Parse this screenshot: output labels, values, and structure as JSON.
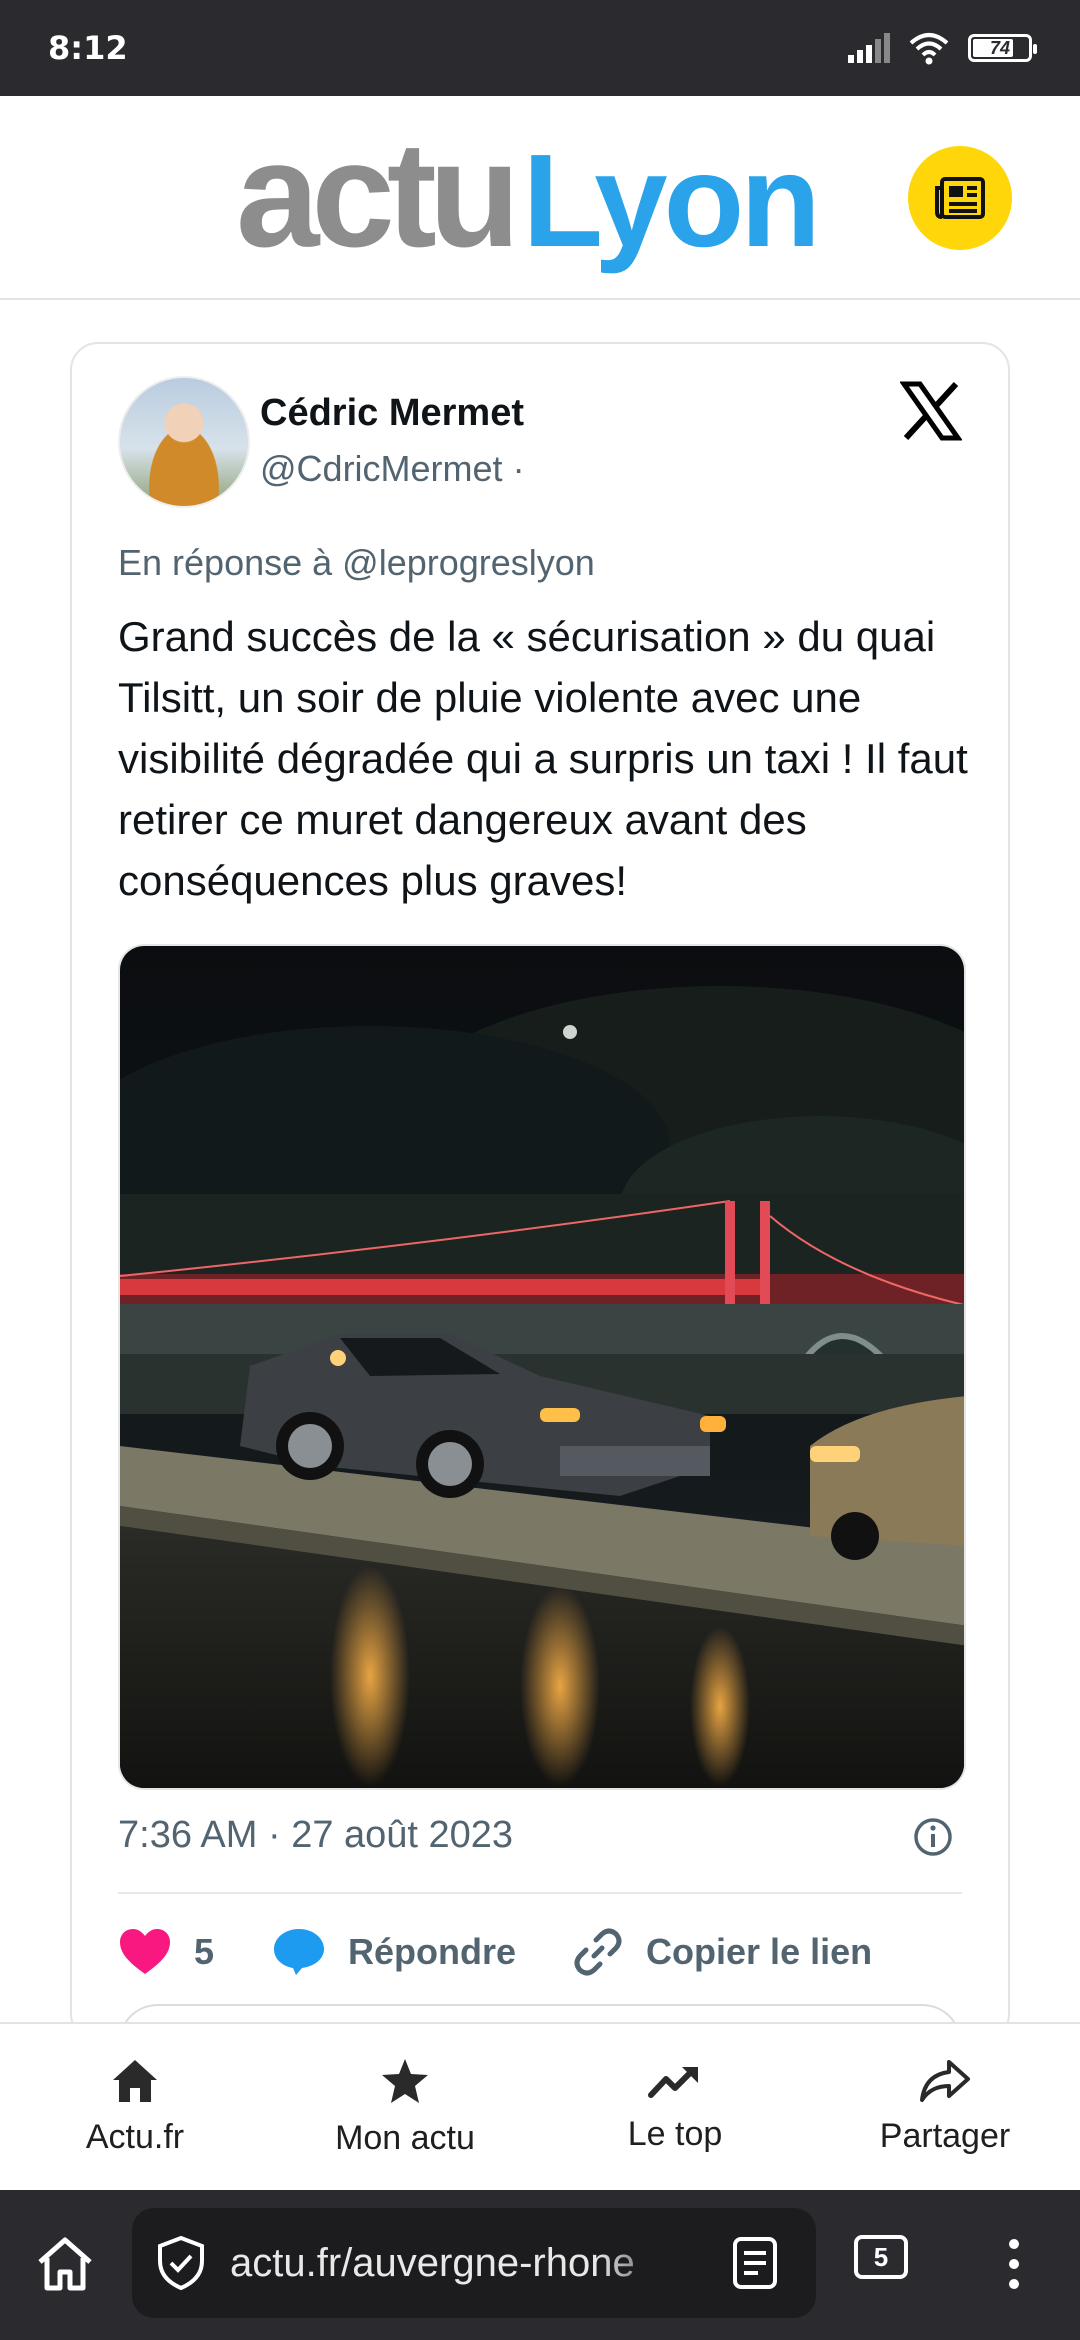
{
  "status_bar": {
    "time": "8:12",
    "battery": "74",
    "battery_level": 0.74
  },
  "site": {
    "logo_part1": "actu",
    "logo_part2": "Lyon",
    "news_icon": "newspaper-icon"
  },
  "tweet": {
    "author_name": "Cédric Mermet",
    "author_handle": "@CdricMermet ·",
    "reply_to": "En réponse à @leprogreslyon",
    "text": "Grand succès de la « sécurisation » du quai Tilsitt, un soir de pluie violente avec une visibilité dégradée qui a surpris un taxi ! Il faut retirer ce muret dangereux avant des conséquences plus graves!",
    "timestamp": "7:36 AM · 27 août 2023",
    "likes": "5",
    "reply_label": "Répondre",
    "copy_label": "Copier le lien"
  },
  "bottom_nav": [
    {
      "label": "Actu.fr",
      "icon": "home-icon"
    },
    {
      "label": "Mon actu",
      "icon": "star-icon"
    },
    {
      "label": "Le top",
      "icon": "trending-icon"
    },
    {
      "label": "Partager",
      "icon": "share-icon"
    }
  ],
  "browser": {
    "url": "actu.fr/auvergne-rhone",
    "tabs_count": "5"
  },
  "colors": {
    "accent_blue": "#2aa3ea",
    "logo_gray": "#8d8d8d",
    "yellow": "#ffd60a",
    "like_pink": "#f91880",
    "reply_blue": "#1d9bf0"
  }
}
